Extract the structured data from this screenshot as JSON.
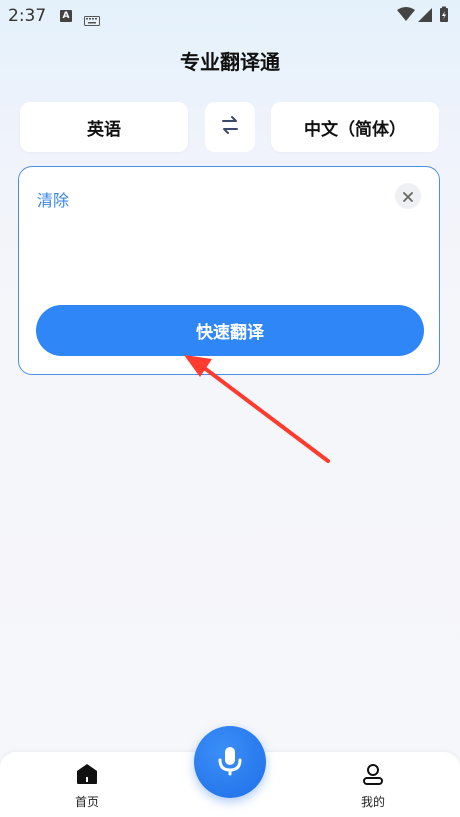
{
  "status_bar": {
    "time": "2:37",
    "indicator_a": "A",
    "icons": [
      "text-indicator-icon",
      "keyboard-icon",
      "wifi-icon",
      "signal-icon",
      "battery-icon"
    ]
  },
  "header": {
    "title": "专业翻译通"
  },
  "language": {
    "source": "英语",
    "target": "中文（简体）",
    "swap_icon": "swap-arrows-icon"
  },
  "input": {
    "clear_label": "清除",
    "close_icon": "close-icon",
    "translate_label": "快速翻译",
    "text": ""
  },
  "annotation": {
    "color": "#ff3b30",
    "icon": "red-arrow-pointer"
  },
  "bottom_nav": {
    "home_label": "首页",
    "mine_label": "我的",
    "mic_icon": "microphone-icon"
  },
  "colors": {
    "accent": "#2f86f6",
    "border": "#4a8fe7"
  }
}
